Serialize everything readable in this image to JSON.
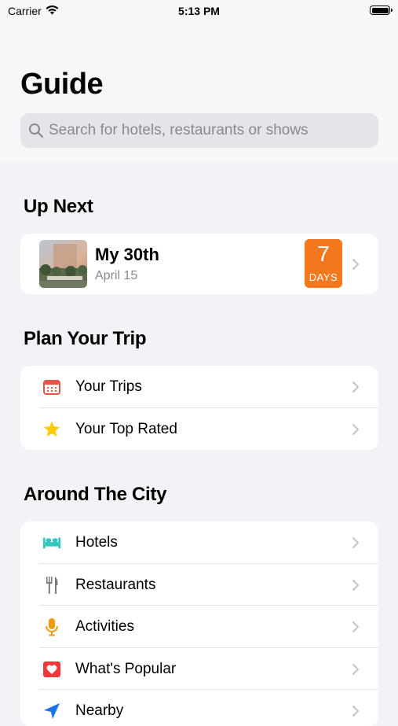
{
  "status_bar": {
    "carrier": "Carrier",
    "time": "5:13 PM"
  },
  "header": {
    "title": "Guide",
    "search_placeholder": "Search for hotels, restaurants or shows"
  },
  "up_next": {
    "section_title": "Up Next",
    "item": {
      "title": "My 30th",
      "date": "April 15",
      "days_count": "7",
      "days_label": "DAYS"
    }
  },
  "plan_trip": {
    "section_title": "Plan Your Trip",
    "items": [
      {
        "label": "Your Trips",
        "icon": "calendar-icon"
      },
      {
        "label": "Your Top Rated",
        "icon": "star-icon"
      }
    ]
  },
  "around_city": {
    "section_title": "Around The City",
    "items": [
      {
        "label": "Hotels",
        "icon": "bed-icon"
      },
      {
        "label": "Restaurants",
        "icon": "fork-knife-icon"
      },
      {
        "label": "Activities",
        "icon": "microphone-icon"
      },
      {
        "label": "What's Popular",
        "icon": "heart-icon"
      },
      {
        "label": "Nearby",
        "icon": "location-arrow-icon"
      }
    ]
  },
  "colors": {
    "accent_orange": "#f4781e",
    "calendar_red": "#e8534a",
    "star_yellow": "#ffcc00",
    "hotel_teal": "#30c7be",
    "activity_orange": "#f29a0f",
    "popular_red": "#f0383a",
    "nearby_blue": "#1a73e8"
  }
}
